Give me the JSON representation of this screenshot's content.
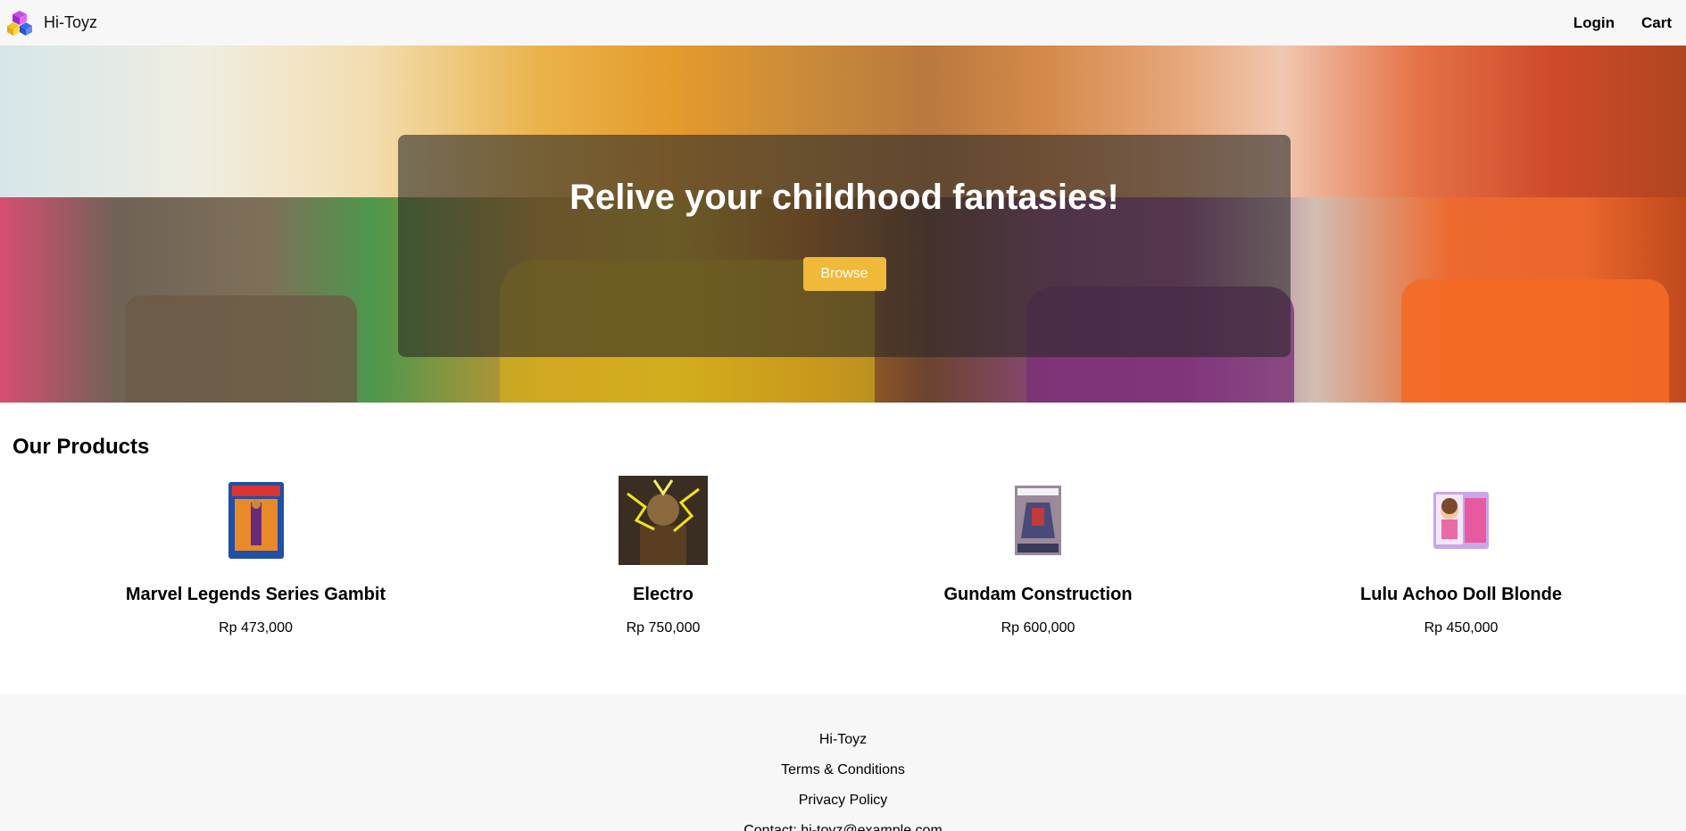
{
  "header": {
    "brand": "Hi-Toyz",
    "nav": [
      {
        "label": "Login"
      },
      {
        "label": "Cart"
      }
    ]
  },
  "hero": {
    "title": "Relive your childhood fantasies!",
    "button_label": "Browse"
  },
  "products": {
    "section_title": "Our Products",
    "items": [
      {
        "name": "Marvel Legends Series Gambit",
        "price": "Rp 473,000"
      },
      {
        "name": "Electro",
        "price": "Rp 750,000"
      },
      {
        "name": "Gundam Construction",
        "price": "Rp 600,000"
      },
      {
        "name": "Lulu Achoo Doll Blonde",
        "price": "Rp 450,000"
      }
    ]
  },
  "footer": {
    "brand": "Hi-Toyz",
    "terms": "Terms & Conditions",
    "privacy": "Privacy Policy",
    "contact": "Contact: hi-toyz@example.com"
  },
  "colors": {
    "accent": "#f0b93a",
    "header_bg": "#f7f7f7",
    "footer_bg": "#f7f7f7"
  }
}
